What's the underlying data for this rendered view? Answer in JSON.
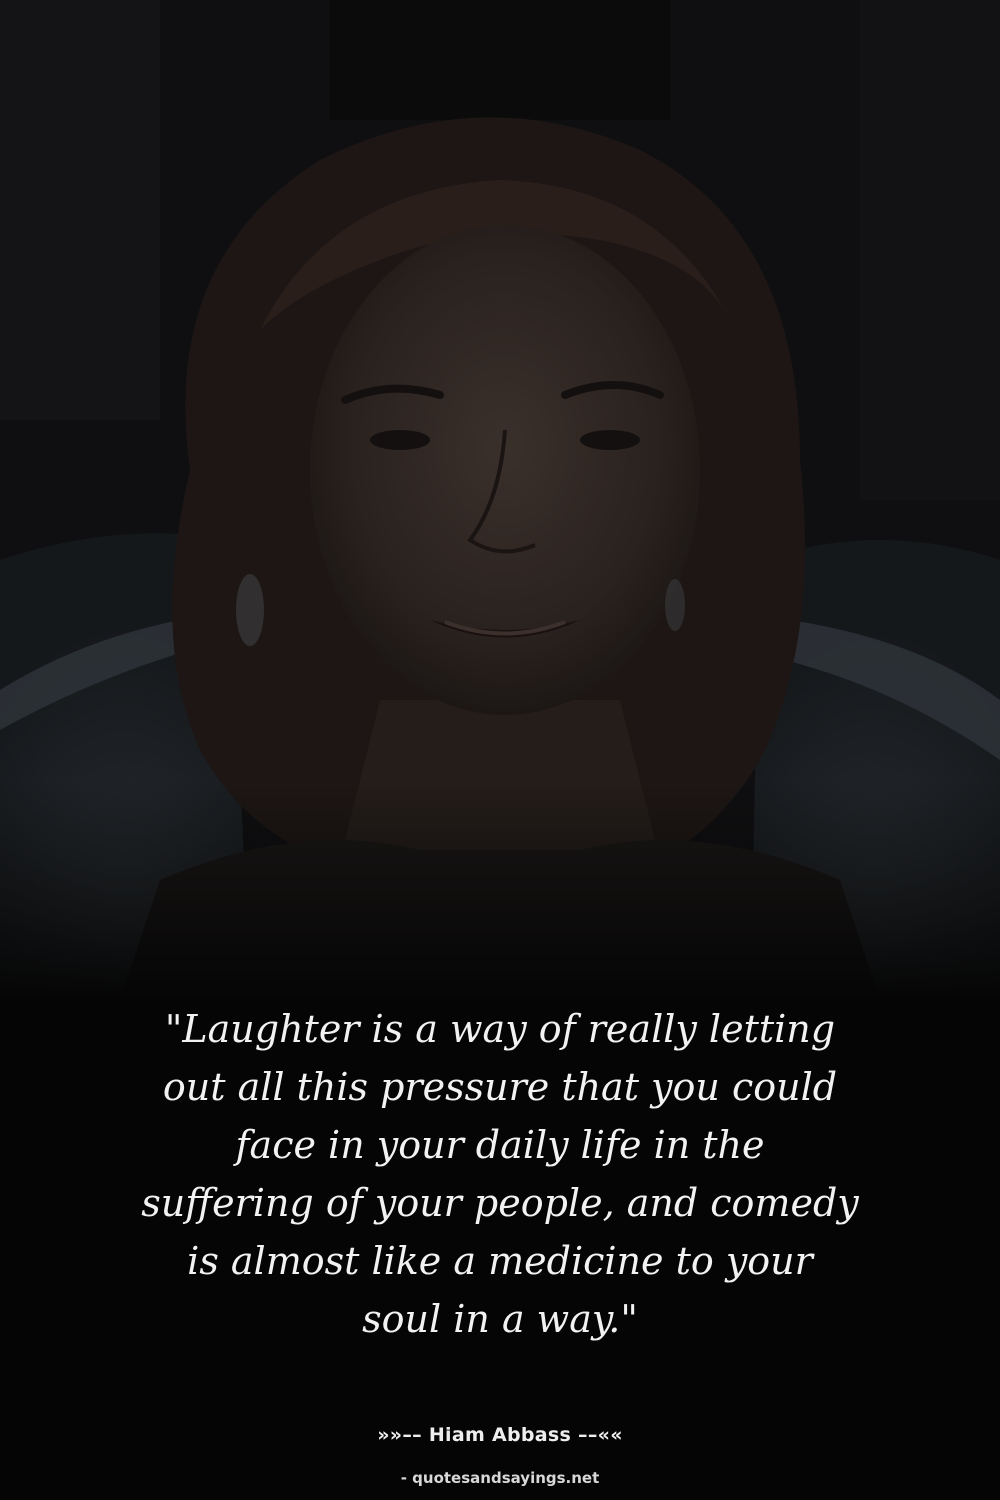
{
  "photo": {
    "subject": "portrait-photo"
  },
  "quote": {
    "lines": [
      "\"Laughter is a way of really letting",
      "out all this pressure that you could",
      "face in your daily life in the",
      "suffering of your people, and comedy",
      "is almost like a medicine to your",
      "soul in a way.\""
    ]
  },
  "author": "»»–– Hiam Abbass ––««",
  "source": "- quotesandsayings.net",
  "colors": {
    "background": "#050505",
    "text": "#f2f2f2"
  }
}
